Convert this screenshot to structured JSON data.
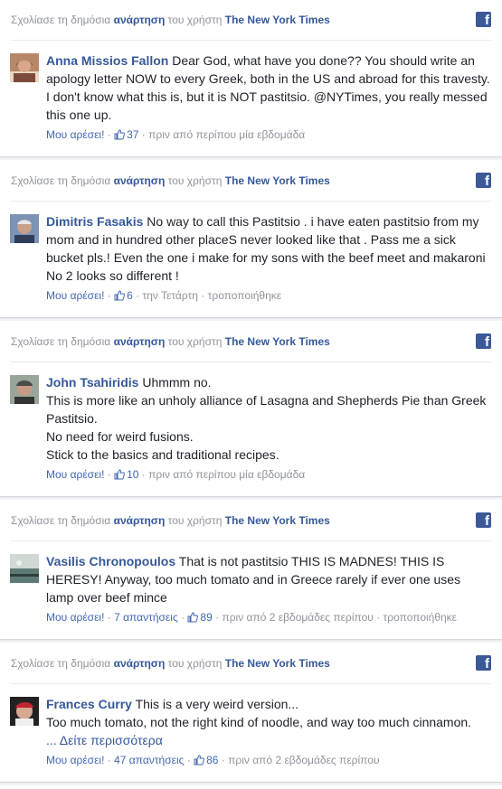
{
  "header": {
    "prefix": "Σχολίασε τη δημόσια ",
    "post_link": "ανάρτηση",
    "middle": " του χρήστη ",
    "page_link": "The New York Times",
    "fb_icon": "facebook-icon"
  },
  "posts": [
    {
      "author": "Anna Missios Fallon",
      "text": "Dear God, what have you done?? You should write an apology letter NOW to every Greek, both in the US and abroad for this travesty. I don't know what this is, but it is NOT pastitsio. @NYTimes, you really messed this one up.",
      "extra_lines": [],
      "see_more": "",
      "like_label": "Μου αρέσει!",
      "replies": "",
      "likes": "37",
      "time": "πριν από περίπου μία εβδομάδα",
      "edited": ""
    },
    {
      "author": "Dimitris Fasakis",
      "text": "No way to call this Pastitsio . i have eaten pastitsio from my mom and in hundred other placeS never looked like that . Pass me a sick bucket pls.! Even the one i make for my sons with the beef meet and makaroni No 2 looks so different !",
      "extra_lines": [],
      "see_more": "",
      "like_label": "Μου αρέσει!",
      "replies": "",
      "likes": "6",
      "time": "την Τετάρτη",
      "edited": "τροποποιήθηκε"
    },
    {
      "author": "John Tsahiridis",
      "text": "Uhmmm no.",
      "extra_lines": [
        "This is more like an unholy alliance of Lasagna and Shepherds Pie than Greek Pastitsio.",
        "No need for weird fusions.",
        "Stick to the basics and traditional recipes."
      ],
      "see_more": "",
      "like_label": "Μου αρέσει!",
      "replies": "",
      "likes": "10",
      "time": "πριν από περίπου μία εβδομάδα",
      "edited": ""
    },
    {
      "author": "Vasilis Chronopoulos",
      "text": "That is not pastitsio THIS IS MADNES! THIS IS HERESY! Anyway, too much tomato and in Greece rarely if ever one uses lamp over beef mince",
      "extra_lines": [],
      "see_more": "",
      "like_label": "Μου αρέσει!",
      "replies": "7 απαντήσεις",
      "likes": "89",
      "time": "πριν από 2 εβδομάδες περίπου",
      "edited": "τροποποιήθηκε"
    },
    {
      "author": "Frances Curry",
      "text": "This is a very weird version...",
      "extra_lines": [
        "Too much tomato, not the right kind of noodle, and way too much cinnamon."
      ],
      "see_more": "... Δείτε περισσότερα",
      "like_label": "Μου αρέσει!",
      "replies": "47 απαντήσεις",
      "likes": "86",
      "time": "πριν από 2 εβδομάδες περίπου",
      "edited": ""
    }
  ],
  "colors": {
    "link": "#365899",
    "meta": "#90949c",
    "text": "#1d2129",
    "facebook": "#3b5998"
  }
}
